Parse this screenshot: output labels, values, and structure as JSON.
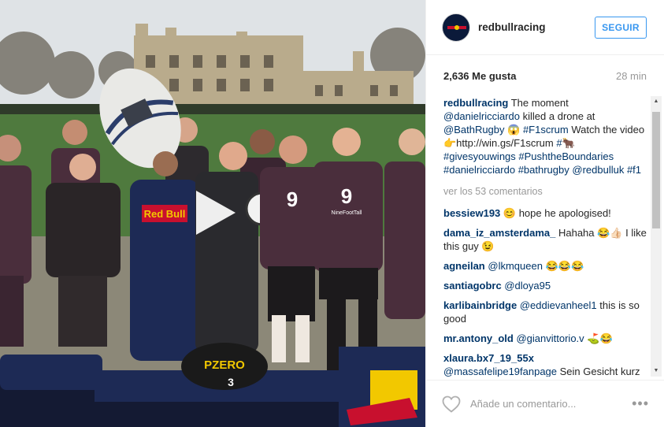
{
  "header": {
    "username": "redbullracing",
    "follow_label": "SEGUIR"
  },
  "meta": {
    "likes": "2,636 Me gusta",
    "time": "28 min"
  },
  "caption": {
    "user": "redbullracing",
    "text_1": " The moment ",
    "link_1": "@danielricciardo",
    "text_2": " killed a drone at ",
    "link_2": "@BathRugby",
    "text_3": " 😱 ",
    "link_3": "#F1scrum",
    "text_4": " Watch the video 👉http://win.gs/F1scrum ",
    "link_4": "#🐂",
    "link_5": "#givesyouwings",
    "link_6": "#PushtheBoundaries",
    "link_7": "#danielricciardo",
    "link_8": "#bathrugby",
    "link_9": "@redbulluk",
    "link_10": "#f1"
  },
  "view_all": "ver los 53 comentarios",
  "comments": [
    {
      "user": "bessiew193",
      "text": " 😊 hope he apologised!"
    },
    {
      "user": "dama_iz_amsterdama_",
      "text": " Hahaha 😂👍🏻 I like this guy 😉"
    },
    {
      "user": "agneilan",
      "mention": "@lkmqueen",
      "text": " 😂😂😂"
    },
    {
      "user": "santiagobrc",
      "mention": "@dloya95",
      "text": ""
    },
    {
      "user": "karlibainbridge",
      "mention": "@eddievanheel1",
      "text": " this is so good"
    },
    {
      "user": "mr.antony_old",
      "mention": "@gianvittorio.v",
      "text": " ⛳😂"
    },
    {
      "user": "xlaura.bx7_19_55x",
      "mention": "@massafelipe19fanpage",
      "text": " Sein Gesicht kurz bevor er die Drohne trifft. 😂😂😂♥😊"
    }
  ],
  "footer": {
    "placeholder": "Añade un comentario...",
    "more": "•••"
  },
  "media": {
    "shirt_logo": "9",
    "shirt_text": "NineFootTall",
    "suit_text": "Red Bull",
    "tyre_text": "PZERO",
    "car_number": "3"
  },
  "colors": {
    "link": "#003569",
    "follow": "#3897f0",
    "jersey": "#4a2e3c",
    "suit": "#1d2a55"
  }
}
